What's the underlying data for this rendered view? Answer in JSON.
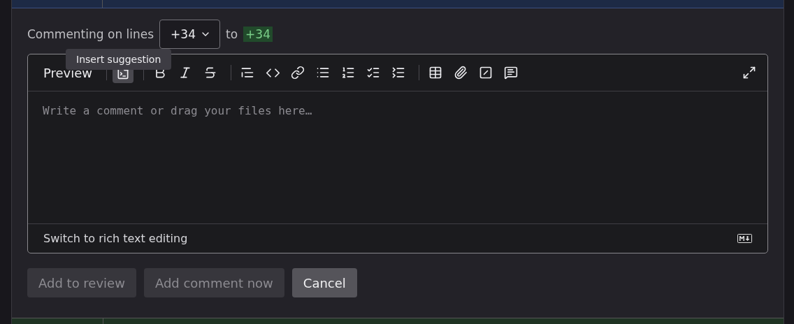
{
  "commenting": {
    "prefix": "Commenting on lines",
    "start": "+34",
    "joiner": "to",
    "end": "+34"
  },
  "tooltip": "Insert suggestion",
  "editor": {
    "preview_tab": "Preview",
    "toolbar_groups": [
      [
        {
          "kind": "suggestion",
          "hovered": true
        }
      ],
      [
        {
          "kind": "bold",
          "hovered": false
        },
        {
          "kind": "italic",
          "hovered": false
        },
        {
          "kind": "strike",
          "hovered": false
        }
      ],
      [
        {
          "kind": "quote",
          "hovered": false
        },
        {
          "kind": "code",
          "hovered": false
        },
        {
          "kind": "link",
          "hovered": false
        },
        {
          "kind": "bullets",
          "hovered": false
        },
        {
          "kind": "numbers",
          "hovered": false
        },
        {
          "kind": "tasks",
          "hovered": false
        },
        {
          "kind": "collapsible",
          "hovered": false
        }
      ],
      [
        {
          "kind": "table",
          "hovered": false
        },
        {
          "kind": "attach",
          "hovered": false
        },
        {
          "kind": "slash",
          "hovered": false
        },
        {
          "kind": "comment",
          "hovered": false
        }
      ]
    ],
    "placeholder": "Write a comment or drag your files here…",
    "footer_link": "Switch to rich text editing"
  },
  "buttons": [
    {
      "label": "Add to review",
      "disabled": true
    },
    {
      "label": "Add comment now",
      "disabled": true
    },
    {
      "label": "Cancel",
      "disabled": false
    }
  ]
}
